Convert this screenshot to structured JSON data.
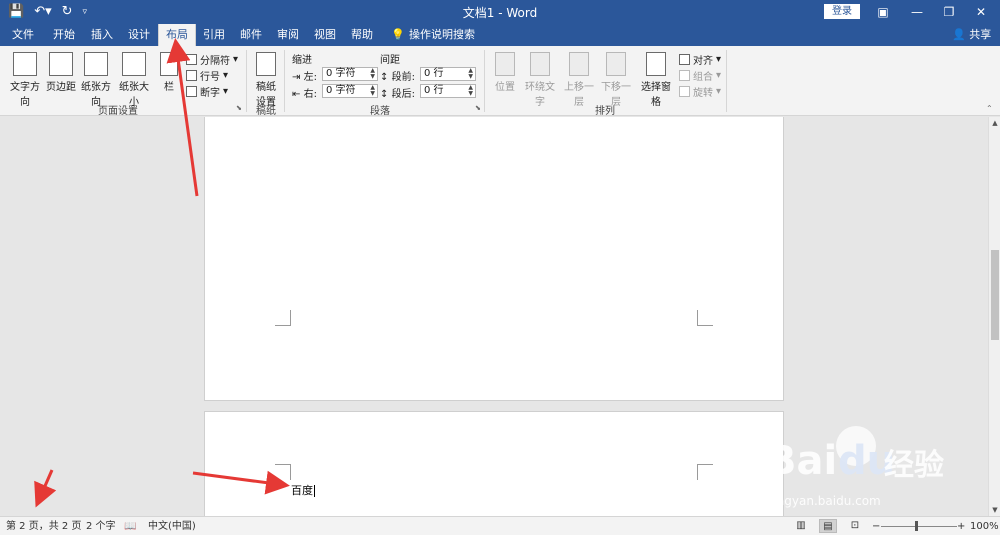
{
  "window": {
    "title": "文档1 - Word",
    "login_label": "登录",
    "share_label": "共享"
  },
  "tabs": [
    "文件",
    "开始",
    "插入",
    "设计",
    "布局",
    "引用",
    "邮件",
    "审阅",
    "视图",
    "帮助"
  ],
  "active_tab": "布局",
  "tell_me": "操作说明搜索",
  "ribbon": {
    "page_setup": {
      "label": "页面设置",
      "text_direction": "文字方向",
      "margins": "页边距",
      "orientation": "纸张方向",
      "size": "纸张大小",
      "columns": "栏",
      "breaks": "分隔符",
      "line_numbers": "行号",
      "hyphenation": "断字"
    },
    "manuscript": {
      "label": "稿纸",
      "settings_line1": "稿纸",
      "settings_line2": "设置"
    },
    "paragraph": {
      "label": "段落",
      "indent_title": "缩进",
      "spacing_title": "间距",
      "left_label": "左:",
      "left_value": "0 字符",
      "right_label": "右:",
      "right_value": "0 字符",
      "before_label": "段前:",
      "before_value": "0 行",
      "after_label": "段后:",
      "after_value": "0 行"
    },
    "arrange": {
      "label": "排列",
      "position": "位置",
      "wrap_text": "环绕文字",
      "bring_forward": "上移一层",
      "send_backward": "下移一层",
      "selection_pane": "选择窗格",
      "align": "对齐",
      "group": "组合",
      "rotate": "旋转"
    }
  },
  "document": {
    "page2_text": "百度"
  },
  "status": {
    "page": "第 2 页，共 2 页",
    "words": "2 个字",
    "language": "中文(中国)",
    "zoom": "100%"
  },
  "watermark": {
    "brand": "Bai",
    "brand2": "du",
    "brand3": "经验",
    "url": "jingyan.baidu.com"
  }
}
